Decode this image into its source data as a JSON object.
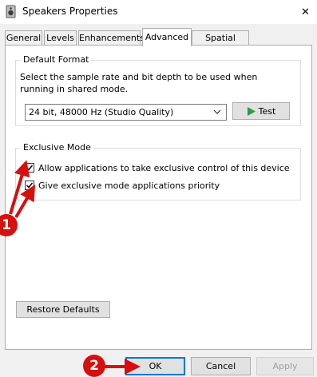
{
  "window": {
    "title": "Speakers Properties",
    "close_glyph": "✕"
  },
  "tabs": [
    {
      "label": "General"
    },
    {
      "label": "Levels"
    },
    {
      "label": "Enhancements"
    },
    {
      "label": "Advanced"
    },
    {
      "label": "Spatial sound"
    }
  ],
  "active_tab": "Advanced",
  "default_format": {
    "group_title": "Default Format",
    "description": "Select the sample rate and bit depth to be used when running in shared mode.",
    "selected_format": "24 bit, 48000 Hz (Studio Quality)",
    "test_button": "Test"
  },
  "exclusive_mode": {
    "group_title": "Exclusive Mode",
    "options": [
      {
        "label": "Allow applications to take exclusive control of this device",
        "checked": true
      },
      {
        "label": "Give exclusive mode applications priority",
        "checked": true
      }
    ]
  },
  "restore_defaults": "Restore Defaults",
  "footer": {
    "ok": "OK",
    "cancel": "Cancel",
    "apply": "Apply"
  },
  "annotations": [
    {
      "number": "1"
    },
    {
      "number": "2"
    }
  ],
  "colors": {
    "annotation_red": "#d60f0f",
    "focus_blue": "#0078d7",
    "test_arrow_green": "#2e9b3c"
  }
}
